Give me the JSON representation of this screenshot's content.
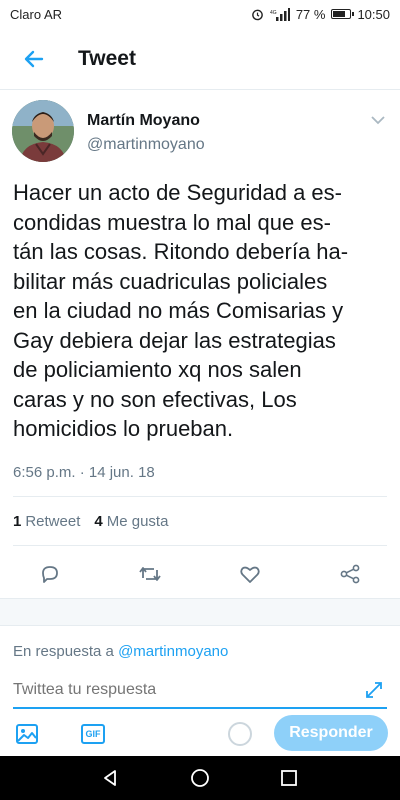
{
  "status_bar": {
    "carrier": "Claro AR",
    "battery_text": "77 %",
    "battery_level": 0.77,
    "time": "10:50",
    "icons": [
      "alarm-icon",
      "signal-icon",
      "battery-icon"
    ]
  },
  "header": {
    "title": "Tweet",
    "back_icon": "arrow-left-icon"
  },
  "tweet": {
    "author_name": "Martín Moyano",
    "author_handle": "@martinmoyano",
    "text_lines": [
      "Hacer un acto de Seguridad a es-",
      "condidas muestra lo mal que es-",
      "tán las cosas. Ritondo debería ha-",
      "bilitar más cuadriculas policiales",
      "en la ciudad no más Comisarias y",
      "Gay debiera dejar las estrategias",
      "de policiamiento xq nos salen",
      "caras y no son efectivas, Los",
      "homicidios lo prueban."
    ],
    "timestamp": "6:56 p.m. · 14 jun. 18",
    "retweets_count": "1",
    "retweets_label": "Retweet",
    "likes_count": "4",
    "likes_label": "Me gusta"
  },
  "actions": [
    "reply-icon",
    "retweet-icon",
    "like-icon",
    "share-icon"
  ],
  "reply": {
    "in_reply_prefix": "En respuesta a",
    "in_reply_handle": "@martinmoyano",
    "placeholder": "Twittea tu respuesta",
    "gif_label": "GIF",
    "submit_label": "Responder"
  },
  "colors": {
    "accent": "#1da1f2",
    "text": "#14171a",
    "secondary_text": "#657786",
    "divider": "#e6ecf0",
    "button_disabled": "#8ed0f9"
  }
}
